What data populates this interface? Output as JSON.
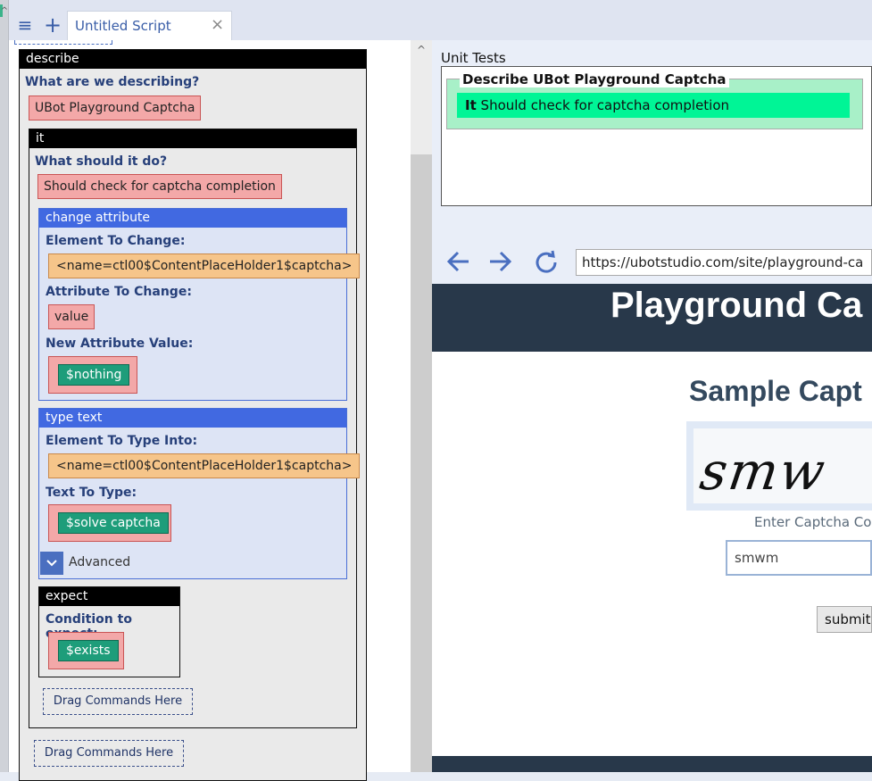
{
  "tabs": {
    "menu_icon": "≡",
    "add_icon": "+",
    "active_tab_label": "Untitled Script",
    "close_icon": "×"
  },
  "script": {
    "describe": {
      "header": "describe",
      "question": "What are we describing?",
      "value": "UBot Playground Captcha"
    },
    "it": {
      "header": "it",
      "question": "What should it do?",
      "value": "Should check for captcha completion"
    },
    "change_attribute": {
      "header": "change attribute",
      "element_label": "Element To Change:",
      "element_value": "<name=ctl00$ContentPlaceHolder1$captcha>",
      "attribute_label": "Attribute To Change:",
      "attribute_value": "value",
      "new_value_label": "New Attribute Value:",
      "new_value_var": "$nothing"
    },
    "type_text": {
      "header": "type text",
      "element_label": "Element To Type Into:",
      "element_value": "<name=ctl00$ContentPlaceHolder1$captcha>",
      "text_label": "Text To Type:",
      "text_var": "$solve captcha",
      "advanced_label": "Advanced"
    },
    "expect": {
      "header": "expect",
      "condition_label": "Condition to expect:",
      "condition_var": "$exists"
    },
    "drag_inner": "Drag Commands Here",
    "drag_outer": "Drag Commands Here"
  },
  "unit_tests": {
    "label": "Unit Tests",
    "group_title": "Describe UBot Playground Captcha",
    "result_prefix": "It",
    "result_text": "Should check for captcha completion",
    "result_color": "#00f596"
  },
  "browser": {
    "back_icon": "arrow-left-icon",
    "forward_icon": "arrow-right-icon",
    "refresh_icon": "refresh-icon",
    "url": "https://ubotstudio.com/site/playground-ca"
  },
  "webpage": {
    "header_title": "Playground Ca",
    "sample_title": "Sample Capt",
    "captcha_image_text": "smw",
    "captcha_label": "Enter Captcha Co",
    "captcha_input_value": "smwm",
    "submit_label": "submit",
    "header_color": "#28384a"
  }
}
